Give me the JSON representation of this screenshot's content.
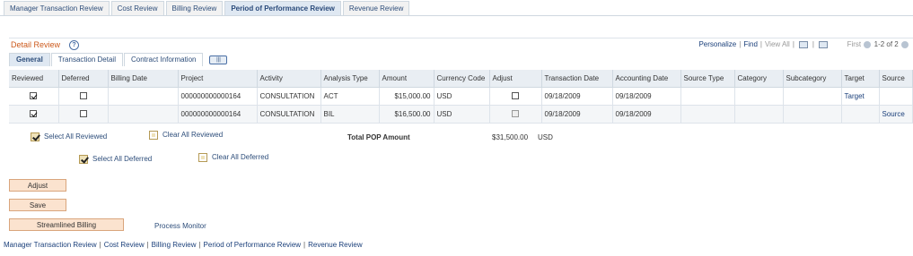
{
  "top_tabs": [
    {
      "label": "Manager Transaction Review",
      "active": false
    },
    {
      "label": "Cost Review",
      "active": false
    },
    {
      "label": "Billing Review",
      "active": false
    },
    {
      "label": "Period of Performance Review",
      "active": true
    },
    {
      "label": "Revenue Review",
      "active": false
    }
  ],
  "grid": {
    "title": "Detail Review",
    "help_icon": "help-icon",
    "personalize": "Personalize",
    "find": "Find",
    "view_all": "View All",
    "nav_first": "First",
    "nav_range": "1-2 of 2"
  },
  "sub_tabs": [
    {
      "label": "General",
      "active": true
    },
    {
      "label": "Transaction Detail",
      "active": false
    },
    {
      "label": "Contract Information",
      "active": false
    }
  ],
  "show_all_tabs_icon": "show-all-columns-icon",
  "columns": [
    "Reviewed",
    "Deferred",
    "Billing Date",
    "Project",
    "Activity",
    "Analysis Type",
    "Amount",
    "Currency Code",
    "Adjust",
    "Transaction Date",
    "Accounting Date",
    "Source Type",
    "Category",
    "Subcategory",
    "Target",
    "Source"
  ],
  "rows": [
    {
      "reviewed": true,
      "deferred": false,
      "billing_date": "",
      "project": "000000000000164",
      "activity": "CONSULTATION",
      "analysis_type": "ACT",
      "amount": "$15,000.00",
      "currency": "USD",
      "adjust": false,
      "transaction_date": "09/18/2009",
      "accounting_date": "09/18/2009",
      "source_type": "",
      "category": "",
      "subcategory": "",
      "target": "Target",
      "source": ""
    },
    {
      "reviewed": true,
      "deferred": false,
      "billing_date": "",
      "project": "000000000000164",
      "activity": "CONSULTATION",
      "analysis_type": "BIL",
      "amount": "$16,500.00",
      "currency": "USD",
      "adjust": false,
      "transaction_date": "09/18/2009",
      "accounting_date": "09/18/2009",
      "source_type": "",
      "category": "",
      "subcategory": "",
      "target": "",
      "source": "Source"
    }
  ],
  "select_all_reviewed": "Select All Reviewed",
  "clear_all_reviewed": "Clear All Reviewed",
  "select_all_deferred": "Select All Deferred",
  "clear_all_deferred": "Clear All Deferred",
  "total": {
    "label": "Total POP Amount",
    "amount": "$31,500.00",
    "currency": "USD"
  },
  "buttons": {
    "adjust": "Adjust",
    "save": "Save",
    "streamlined_billing": "Streamlined Billing"
  },
  "process_monitor": "Process Monitor",
  "bottom_links": [
    "Manager Transaction Review",
    "Cost Review",
    "Billing Review",
    "Period of Performance Review",
    "Revenue Review"
  ],
  "colors": {
    "grid_title": "#cc5a1d",
    "button_bg": "#fbe3cf",
    "tab_active": "#dfe8f2",
    "link": "#2d4d7a"
  }
}
